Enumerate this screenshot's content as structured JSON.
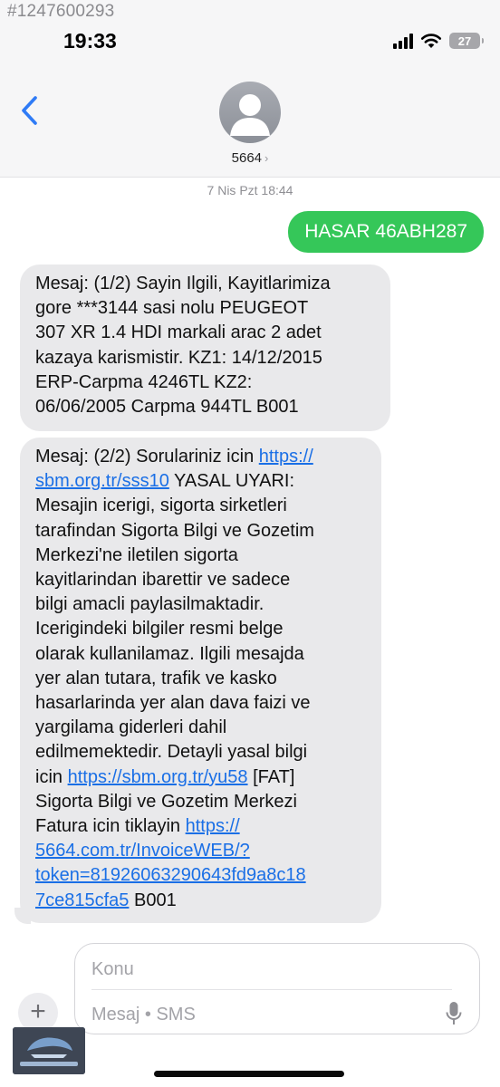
{
  "watermark": {
    "listing_id": "#1247600293"
  },
  "status_bar": {
    "time": "19:33",
    "battery": "27"
  },
  "header": {
    "contact_name": "5664",
    "chevron": "›"
  },
  "messages": {
    "timestamp": "7 Nis Pzt 18:44",
    "outgoing": "HASAR 46ABH287",
    "incoming_1": "Mesaj: (1/2) Sayin Ilgili, Kayitlarimiza\ngore ***3144 sasi nolu PEUGEOT\n307 XR 1.4 HDI markali arac 2 adet\nkazaya karismistir. KZ1: 14/12/2015\nERP-Carpma 4246TL KZ2:\n06/06/2005 Carpma 944TL B001",
    "incoming_2": {
      "text_1": "Mesaj: (2/2) Sorulariniz icin ",
      "link_1": "https://\nsbm.org.tr/sss10",
      "text_2": " YASAL UYARI:\nMesajin icerigi, sigorta sirketleri\ntarafindan Sigorta Bilgi ve Gozetim\nMerkezi'ne iletilen sigorta\nkayitlarindan ibarettir ve sadece\nbilgi amacli paylasilmaktadir.\nIcerigindeki bilgiler resmi belge\nolarak kullanilamaz. Ilgili mesajda\nyer alan tutara, trafik ve kasko\nhasarlarinda yer alan dava faizi ve\nyargilama giderleri dahil\nedilmemektedir. Detayli yasal bilgi\nicin ",
      "link_2": "https://sbm.org.tr/yu58",
      "text_3": " [FAT]\nSigorta Bilgi ve Gozetim Merkezi\nFatura icin tiklayin ",
      "link_3": "https://\n5664.com.tr/InvoiceWEB/?\ntoken=81926063290643fd9a8c18\n7ce815cfa5",
      "text_4": " B001"
    }
  },
  "composer": {
    "plus": "+",
    "subject_placeholder": "Konu",
    "message_placeholder": "Mesaj • SMS"
  },
  "colors": {
    "outgoing_bubble": "#35c759",
    "incoming_bubble": "#e9e9eb",
    "link": "#1a6fe6",
    "accent": "#2f7bf6"
  },
  "icons": [
    "back-chevron-icon",
    "person-icon",
    "signal-icon",
    "wifi-icon",
    "battery-icon",
    "plus-icon",
    "microphone-icon"
  ]
}
